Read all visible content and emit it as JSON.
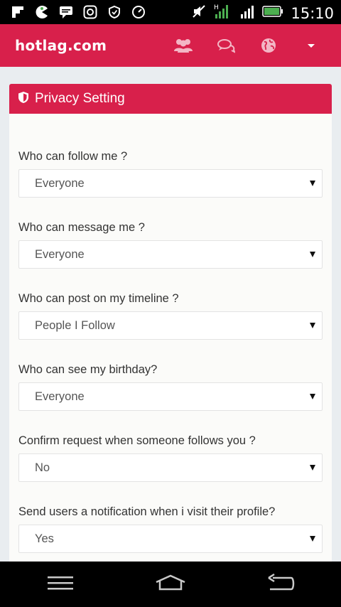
{
  "status_bar": {
    "time": "15:10",
    "icons": [
      "flipboard-icon",
      "pacman-icon",
      "chat-icon",
      "instagram-icon",
      "shield-icon",
      "speedometer-icon"
    ],
    "right_icons": [
      "mute-icon",
      "hplus-signal-icon",
      "cell-signal-icon",
      "battery-icon"
    ]
  },
  "app_bar": {
    "brand": "hotlag.com",
    "icons": [
      "users-icon",
      "chat-bubbles-icon",
      "globe-icon",
      "dropdown-caret-icon"
    ]
  },
  "card": {
    "title": "Privacy Setting",
    "icon": "shield-icon",
    "fields": [
      {
        "label": "Who can follow me ?",
        "value": "Everyone"
      },
      {
        "label": "Who can message me ?",
        "value": "Everyone"
      },
      {
        "label": "Who can post on my timeline ?",
        "value": "People I Follow"
      },
      {
        "label": "Who can see my birthday?",
        "value": "Everyone"
      },
      {
        "label": "Confirm request when someone follows you ?",
        "value": "No"
      },
      {
        "label": "Send users a notification when i visit their profile?",
        "value": "Yes"
      }
    ]
  },
  "nav_bar": {
    "buttons": [
      "menu-icon",
      "home-icon",
      "back-icon"
    ]
  },
  "colors": {
    "accent": "#d8204b",
    "background": "#e9edf0",
    "card": "#fbfbf9"
  }
}
